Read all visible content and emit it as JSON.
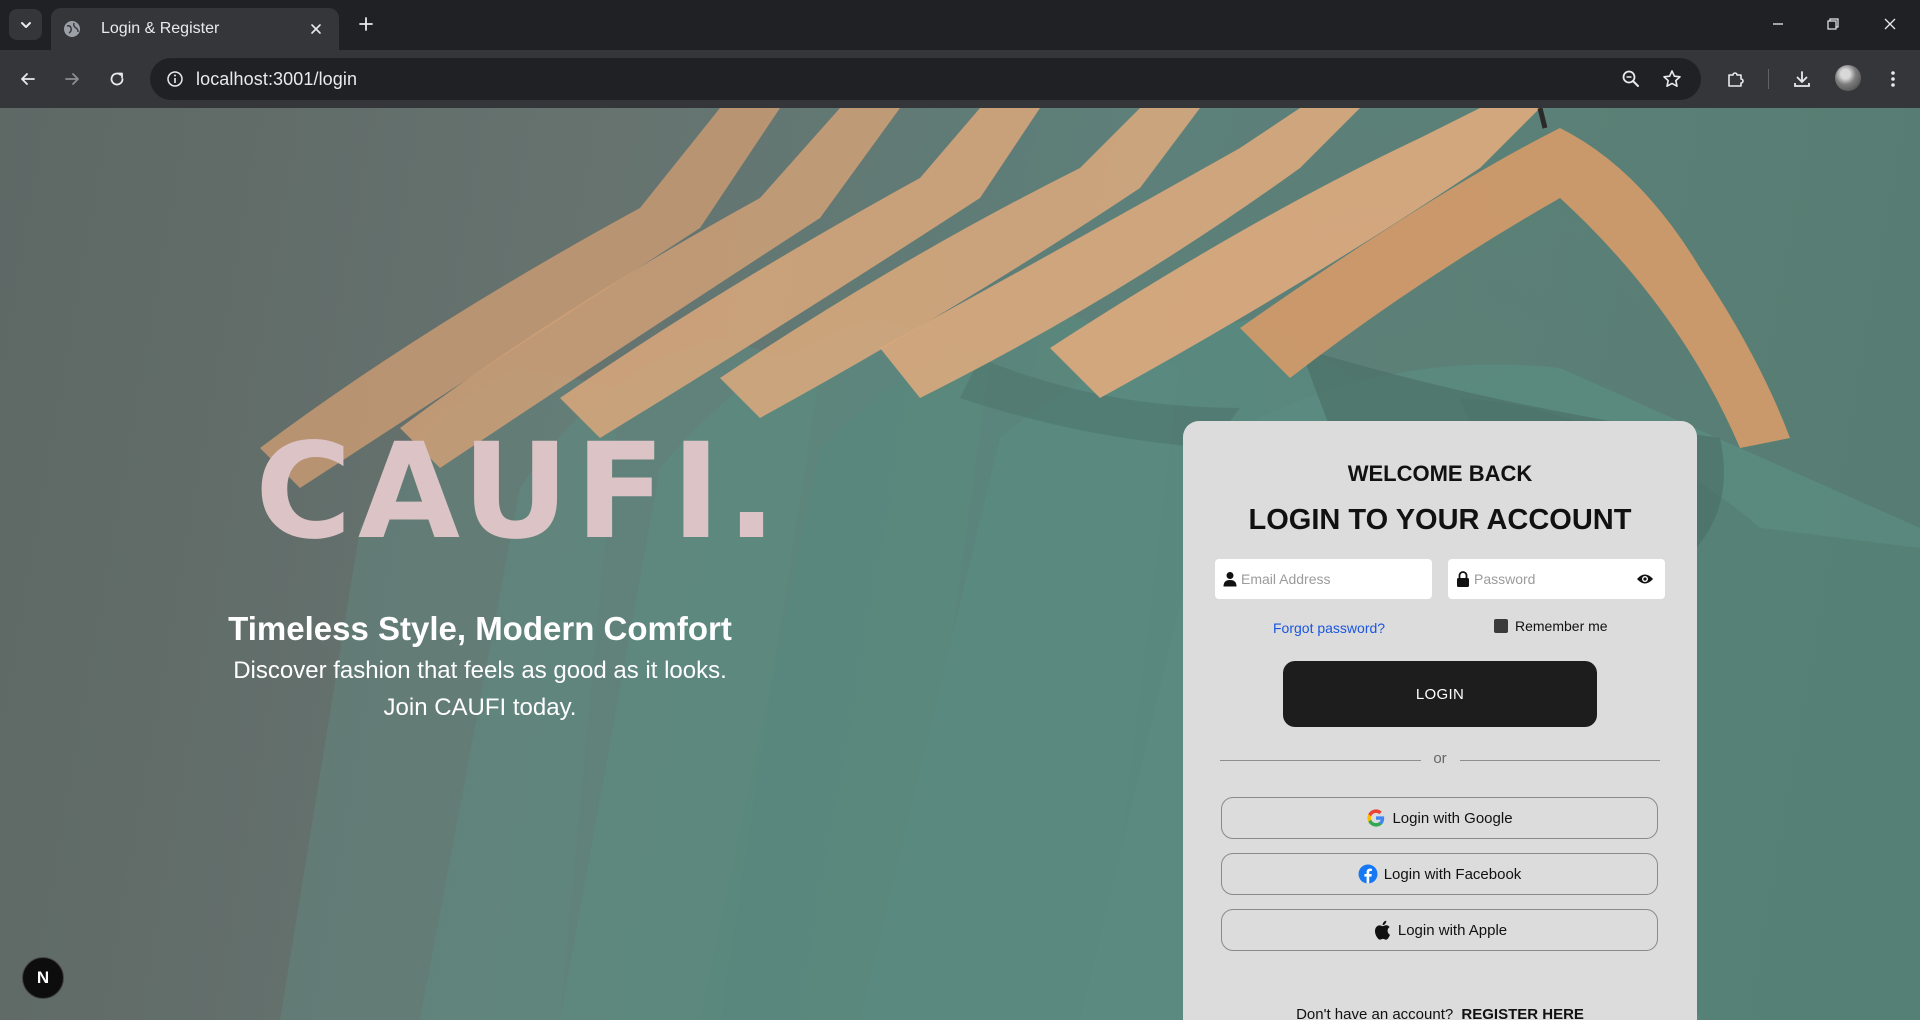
{
  "browser": {
    "tab_title": "Login & Register",
    "url": "localhost:3001/login"
  },
  "hero": {
    "brand": "CAUFI.",
    "tagline": "Timeless Style, Modern Comfort",
    "subline_1": "Discover fashion that feels as good as it looks.",
    "subline_2": "Join CAUFI today."
  },
  "login": {
    "welcome": "WELCOME BACK",
    "heading": "LOGIN TO YOUR ACCOUNT",
    "email_placeholder": "Email Address",
    "password_placeholder": "Password",
    "forgot_label": "Forgot password?",
    "remember_label": "Remember me",
    "login_button": "LOGIN",
    "or_label": "or",
    "google_label": "Login with Google",
    "facebook_label": "Login with Facebook",
    "apple_label": "Login with Apple",
    "no_account_text": "Don't have an account?",
    "register_label": "REGISTER HERE"
  },
  "dev": {
    "badge": "N"
  },
  "colors": {
    "brand_pink": "#dcc3c6",
    "card_bg": "#dcdcdc",
    "button_dark": "#1d1d1d",
    "link_blue": "#1a55e0"
  }
}
